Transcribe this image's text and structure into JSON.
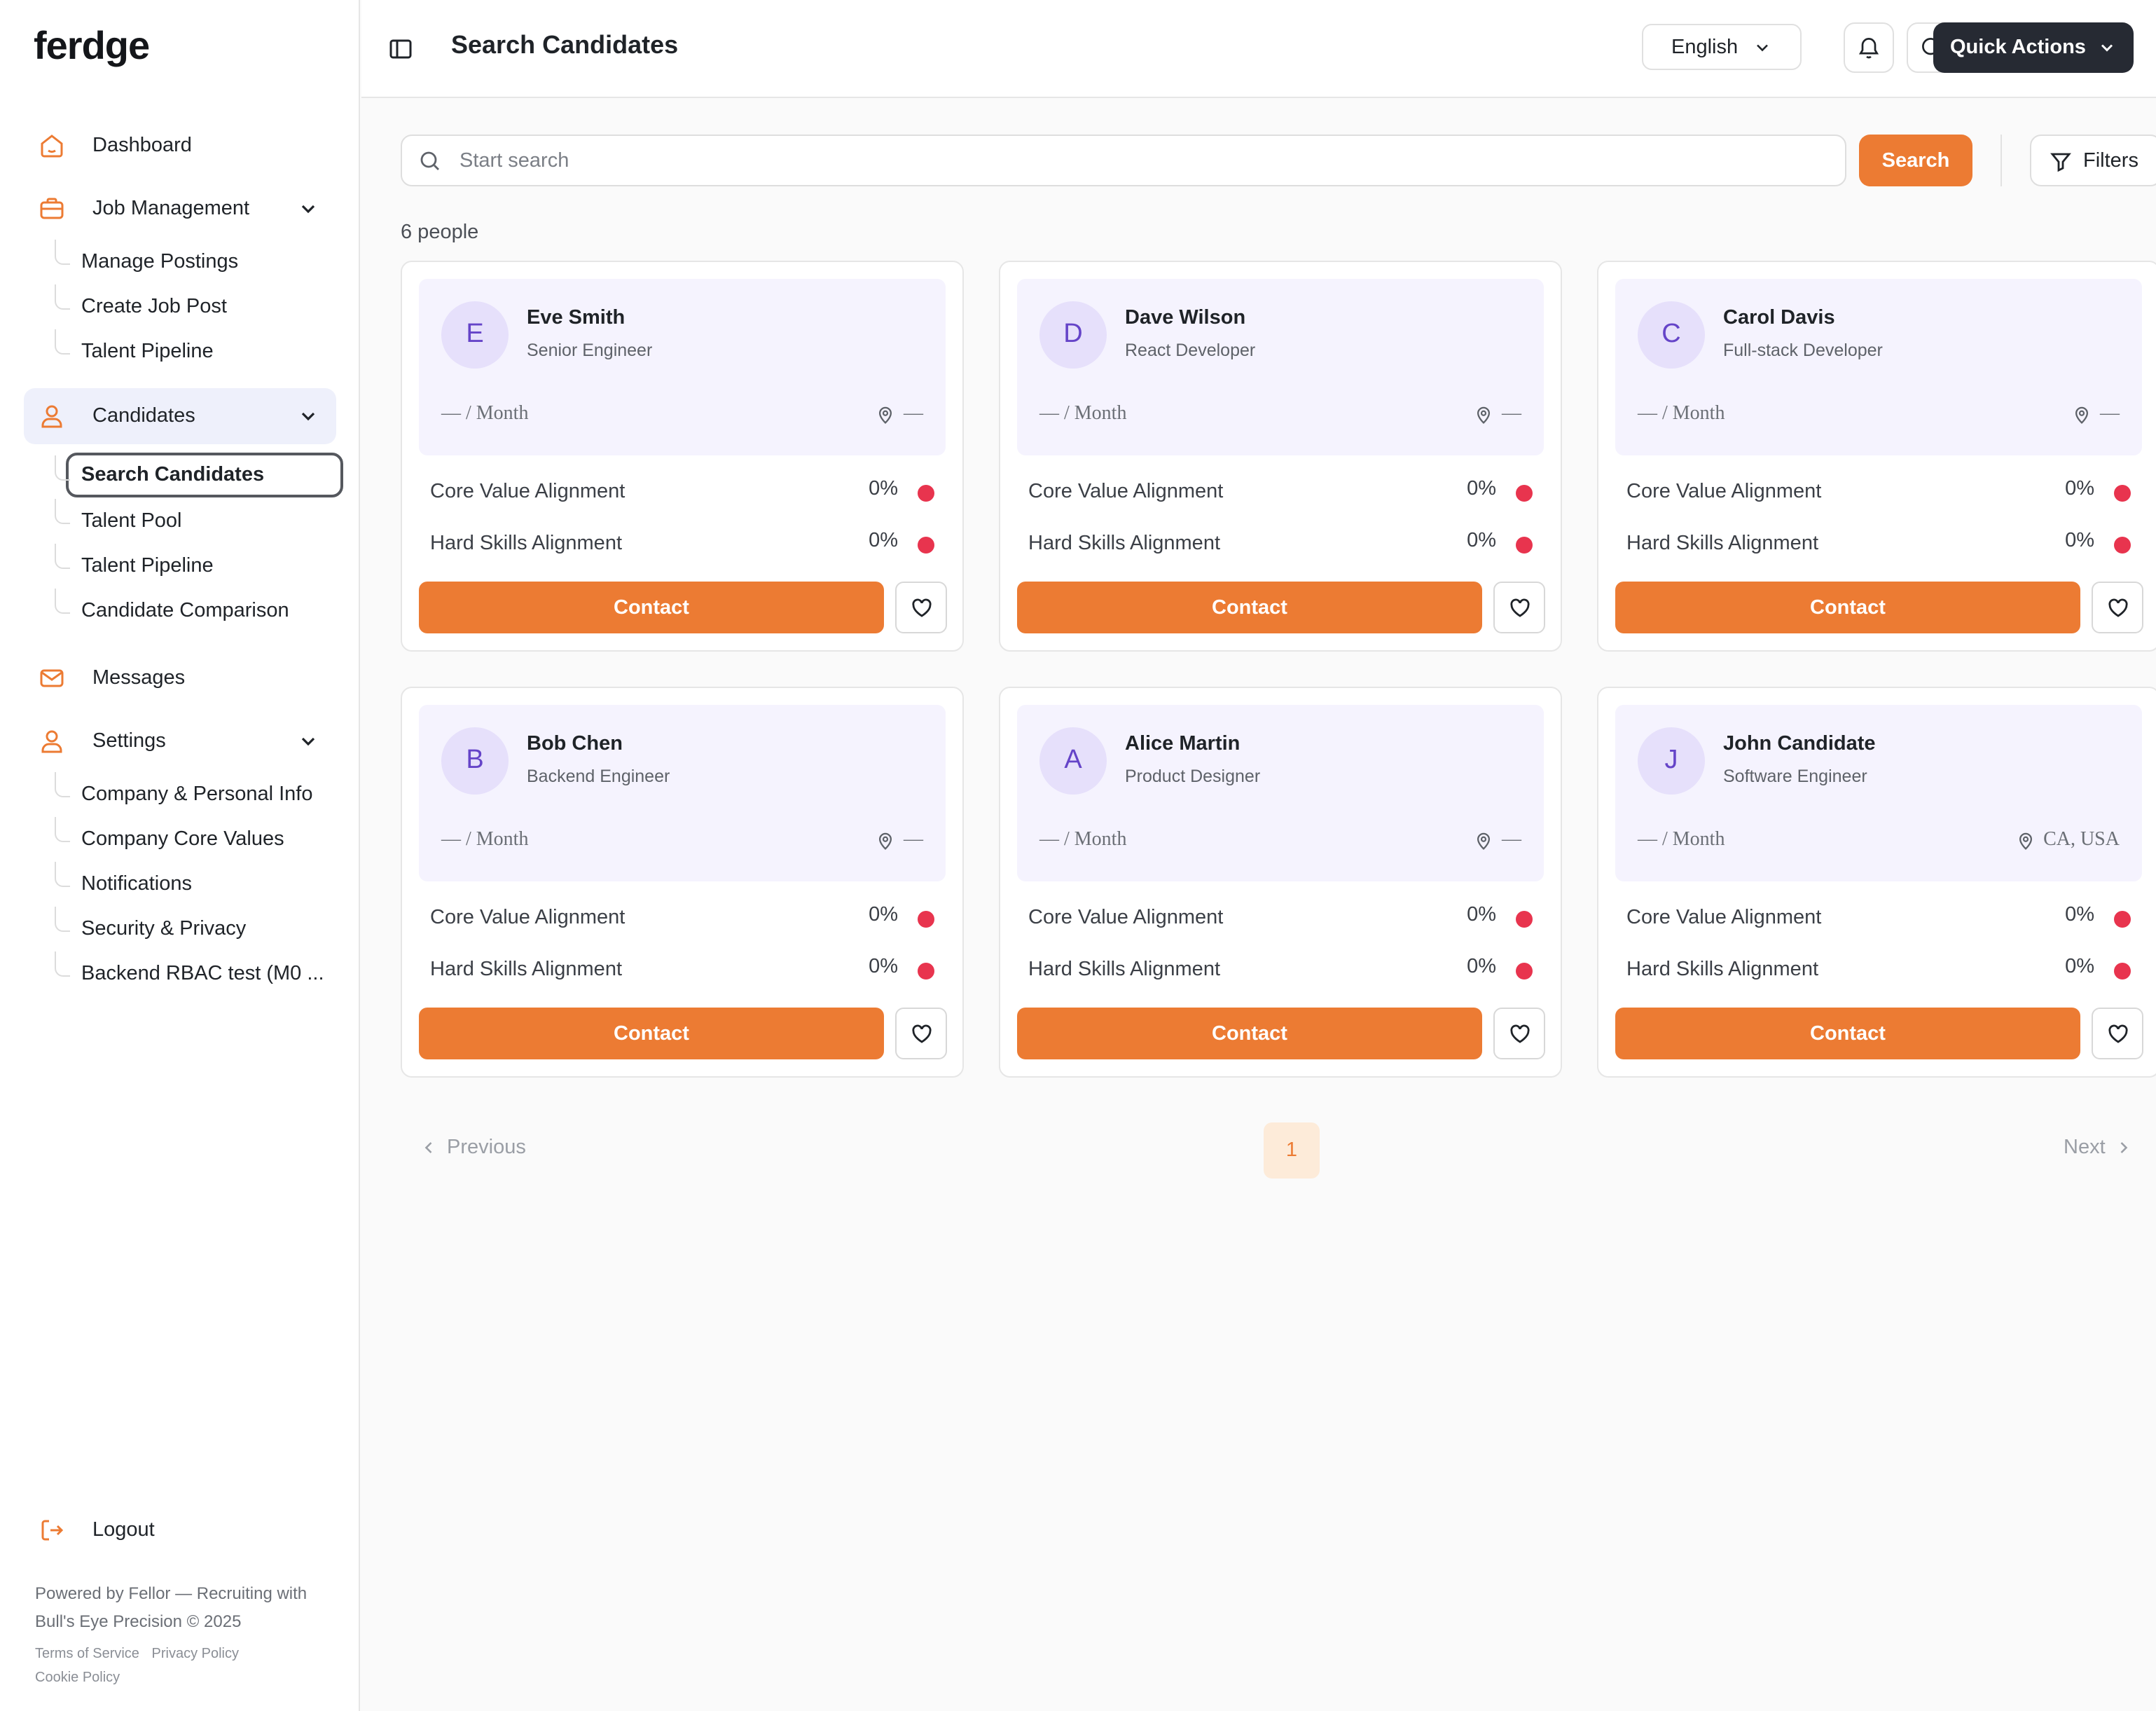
{
  "app": {
    "logo": "ferdge"
  },
  "sidebar": {
    "nav": [
      {
        "label": "Dashboard",
        "icon": "home-icon"
      },
      {
        "label": "Job Management",
        "icon": "briefcase-icon",
        "expanded": true,
        "children": [
          "Manage Postings",
          "Create Job Post",
          "Talent Pipeline"
        ]
      },
      {
        "label": "Candidates",
        "icon": "user-icon",
        "expanded": true,
        "active": true,
        "children": [
          "Search Candidates",
          "Talent Pool",
          "Talent Pipeline",
          "Candidate Comparison"
        ]
      },
      {
        "label": "Messages",
        "icon": "mail-icon"
      },
      {
        "label": "Settings",
        "icon": "user-icon",
        "expanded": true,
        "children": [
          "Company & Personal Info",
          "Company Core Values",
          "Notifications",
          "Security & Privacy",
          "Backend RBAC test (M0 ..."
        ]
      }
    ],
    "logout": "Logout",
    "powered": "Powered by Fellor — Recruiting with Bull's Eye Precision © 2025",
    "legal": [
      "Terms of Service",
      "Privacy Policy",
      "Cookie Policy"
    ]
  },
  "header": {
    "title": "Search Candidates",
    "language": "English",
    "quick_actions": "Quick Actions"
  },
  "search": {
    "placeholder": "Start search",
    "button": "Search",
    "filters": "Filters",
    "count": "6 people"
  },
  "card_labels": {
    "core": "Core Value Alignment",
    "hard": "Hard Skills Alignment",
    "contact": "Contact"
  },
  "candidates": [
    {
      "initial": "E",
      "name": "Eve Smith",
      "role": "Senior Engineer",
      "salary": "— / Month",
      "location": "—",
      "core": "0%",
      "hard": "0%"
    },
    {
      "initial": "D",
      "name": "Dave Wilson",
      "role": "React Developer",
      "salary": "— / Month",
      "location": "—",
      "core": "0%",
      "hard": "0%"
    },
    {
      "initial": "C",
      "name": "Carol Davis",
      "role": "Full-stack Developer",
      "salary": "— / Month",
      "location": "—",
      "core": "0%",
      "hard": "0%"
    },
    {
      "initial": "B",
      "name": "Bob Chen",
      "role": "Backend Engineer",
      "salary": "— / Month",
      "location": "—",
      "core": "0%",
      "hard": "0%"
    },
    {
      "initial": "A",
      "name": "Alice Martin",
      "role": "Product Designer",
      "salary": "— / Month",
      "location": "—",
      "core": "0%",
      "hard": "0%"
    },
    {
      "initial": "J",
      "name": "John Candidate",
      "role": "Software Engineer",
      "salary": "— / Month",
      "location": "CA, USA",
      "core": "0%",
      "hard": "0%"
    }
  ],
  "pagination": {
    "previous": "Previous",
    "next": "Next",
    "current": "1"
  },
  "colors": {
    "accent": "#ec7b33",
    "dark": "#262a33",
    "avatar_bg": "#e6e0fb",
    "avatar_text": "#6544c8",
    "status_red": "#e8344e"
  }
}
